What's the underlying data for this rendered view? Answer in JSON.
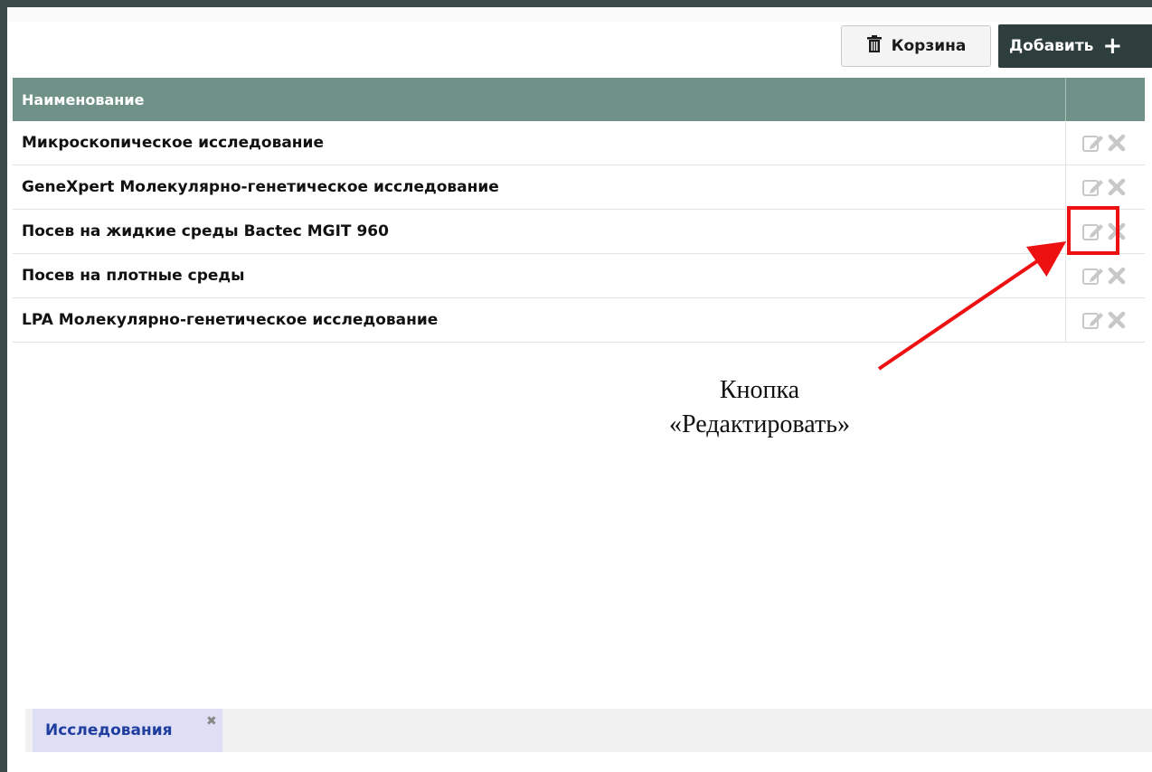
{
  "toolbar": {
    "trash_label": "Корзина",
    "add_label": "Добавить"
  },
  "table": {
    "columns": [
      "Наименование"
    ],
    "rows": [
      {
        "name": "Микроскопическое исследование"
      },
      {
        "name": "GeneXpert Молекулярно-генетическое исследование"
      },
      {
        "name": "Посев на жидкие среды Bactec MGIT 960"
      },
      {
        "name": "Посев на плотные среды"
      },
      {
        "name": "LPA Молекулярно-генетическое исследование"
      }
    ]
  },
  "annotation": {
    "line1": "Кнопка",
    "line2": "«Редактировать»",
    "color": "#ee1111"
  },
  "tabs": [
    {
      "label": "Исследования"
    }
  ],
  "icons": {
    "trash": "trash-icon",
    "add": "plus-icon",
    "edit": "edit-icon",
    "delete": "delete-icon",
    "tab_close": "close-icon"
  },
  "colors": {
    "header_bg": "#6f9188",
    "add_button_bg": "#2e3e3c",
    "tab_bg": "#dedff5",
    "tab_text": "#1f3ea0"
  }
}
